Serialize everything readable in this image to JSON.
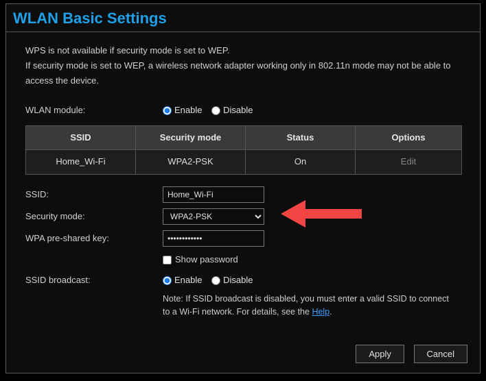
{
  "title": "WLAN Basic Settings",
  "notes": {
    "line1": "WPS is not available if security mode is set to WEP.",
    "line2": "If security mode is set to WEP, a wireless network adapter working only in 802.11n mode may not be able to access the device."
  },
  "labels": {
    "wlan_module": "WLAN module:",
    "ssid": "SSID:",
    "security_mode": "Security mode:",
    "wpa_key": "WPA pre-shared key:",
    "show_password": "Show password",
    "ssid_broadcast": "SSID broadcast:",
    "enable": "Enable",
    "disable": "Disable"
  },
  "table": {
    "headers": {
      "ssid": "SSID",
      "security": "Security mode",
      "status": "Status",
      "options": "Options"
    },
    "row": {
      "ssid": "Home_Wi-Fi",
      "security": "WPA2-PSK",
      "status": "On",
      "options": "Edit"
    }
  },
  "form": {
    "ssid_value": "Home_Wi-Fi",
    "security_mode_value": "WPA2-PSK",
    "wpa_key_value": "••••••••••••"
  },
  "broadcast_note": {
    "prefix": "Note: If SSID broadcast is disabled, you must enter a valid SSID to connect to a Wi-Fi network. For details, see the ",
    "link": "Help",
    "suffix": "."
  },
  "buttons": {
    "apply": "Apply",
    "cancel": "Cancel"
  }
}
